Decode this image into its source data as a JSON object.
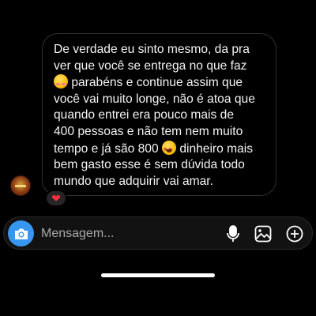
{
  "message": {
    "line1": "De verdade eu sinto mesmo, da pra\nver que você se entrega no que faz\n",
    "line2": " parabéns e continue assim que\nvocê vai muito longe, não é atoa que\nquando entrei era pouco mais de\n400 pessoas e não tem nem muito\ntempo e já são 800 ",
    "line3": " dinheiro mais\nbem gasto esse é sem dúvida todo\nmundo que adquirir vai amar.",
    "emoji_1": "smiling-face-with-party-hat-emoji",
    "emoji_2": "star-struck-emoji",
    "reaction": "❤"
  },
  "composer": {
    "placeholder": "Mensagem..."
  },
  "colors": {
    "accent": "#3797f0",
    "heart": "#ff3040",
    "background": "#000000"
  },
  "icons": {
    "camera": "camera-icon",
    "mic": "microphone-icon",
    "gallery": "gallery-icon",
    "plus": "plus-icon"
  }
}
